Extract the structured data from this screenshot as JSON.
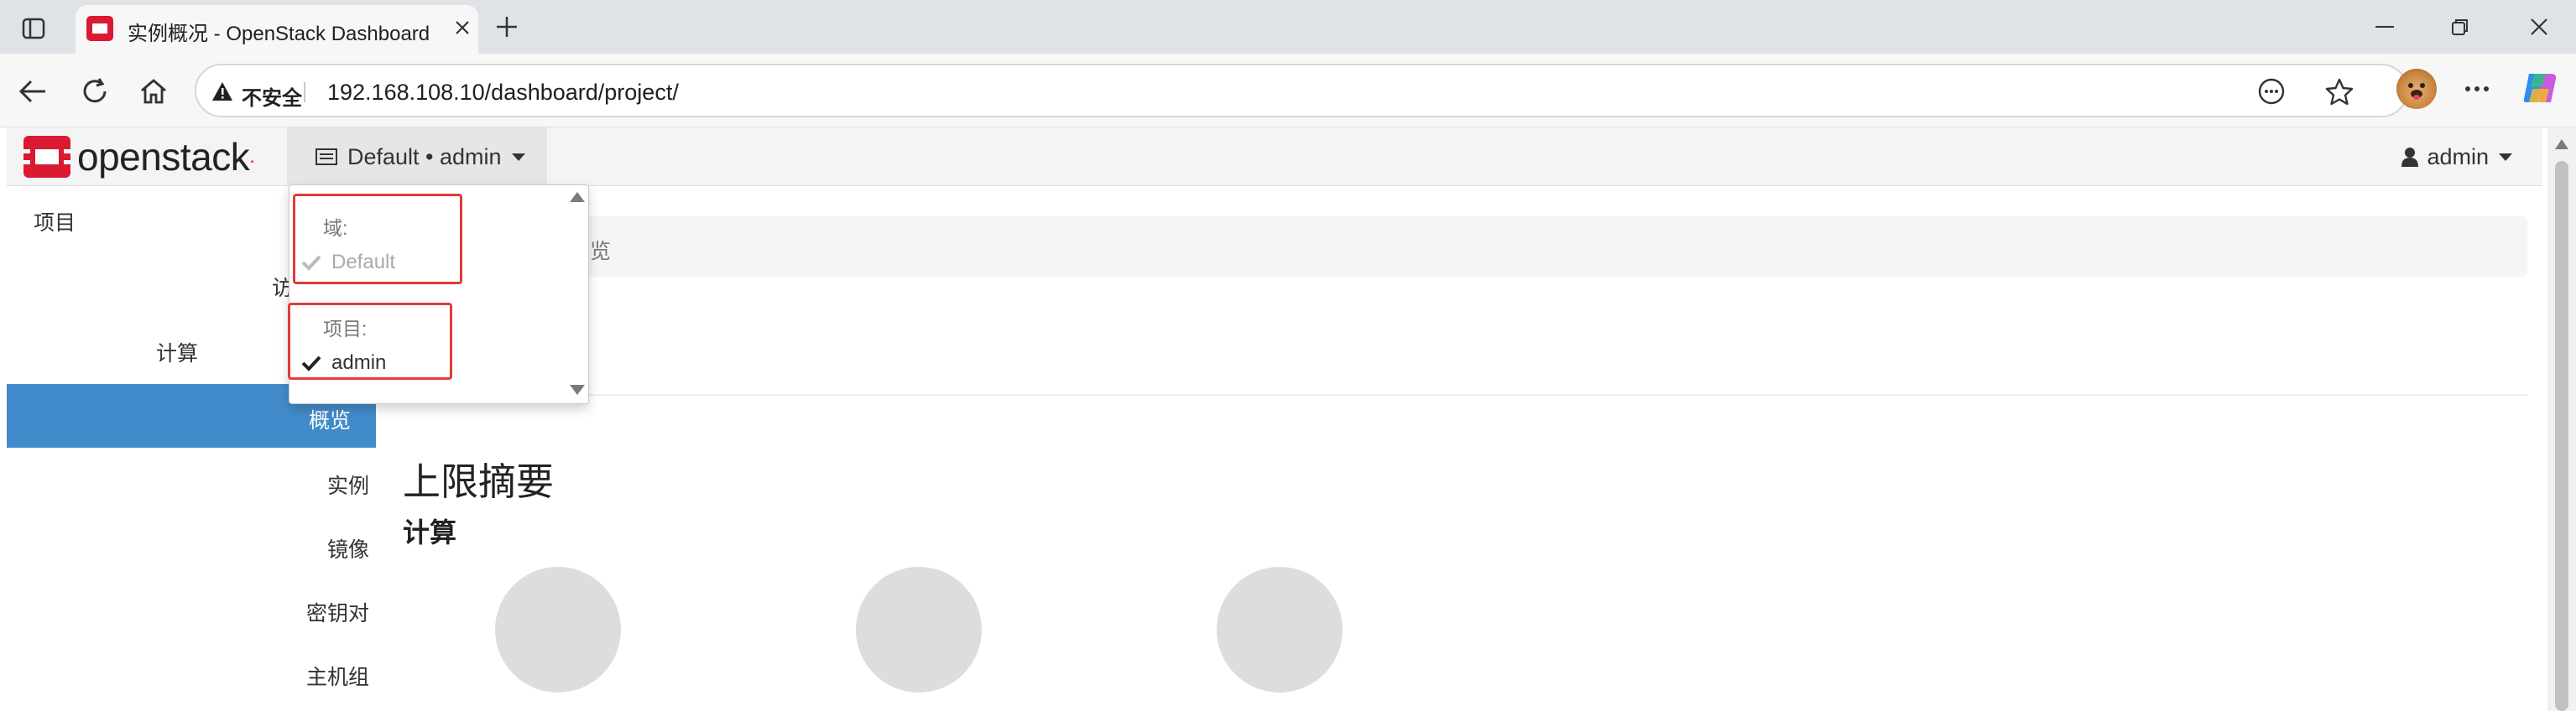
{
  "browser": {
    "tab_title": "实例概况 - OpenStack Dashboard",
    "security_label": "不安全",
    "url": "192.168.108.10/dashboard/project/"
  },
  "topnav": {
    "brand": "openstack",
    "brand_mark": ".",
    "context_label": "Default • admin",
    "user_label": "admin"
  },
  "dropdown": {
    "domain_header": "域:",
    "domain_item": "Default",
    "project_header": "项目:",
    "project_item": "admin"
  },
  "sidebar": {
    "project": "项目",
    "access_partial": "访",
    "compute": "计算",
    "items": [
      {
        "label": "概览",
        "active": true
      },
      {
        "label": "实例",
        "active": false
      },
      {
        "label": "镜像",
        "active": false
      },
      {
        "label": "密钥对",
        "active": false
      },
      {
        "label": "主机组",
        "active": false
      }
    ]
  },
  "main": {
    "breadcrumb_current": "概览",
    "limits_heading": "上限摘要",
    "compute_heading": "计算"
  },
  "colors": {
    "brand_red": "#da1a32",
    "active_blue": "#428bca",
    "highlight_box": "#e33a3a"
  }
}
